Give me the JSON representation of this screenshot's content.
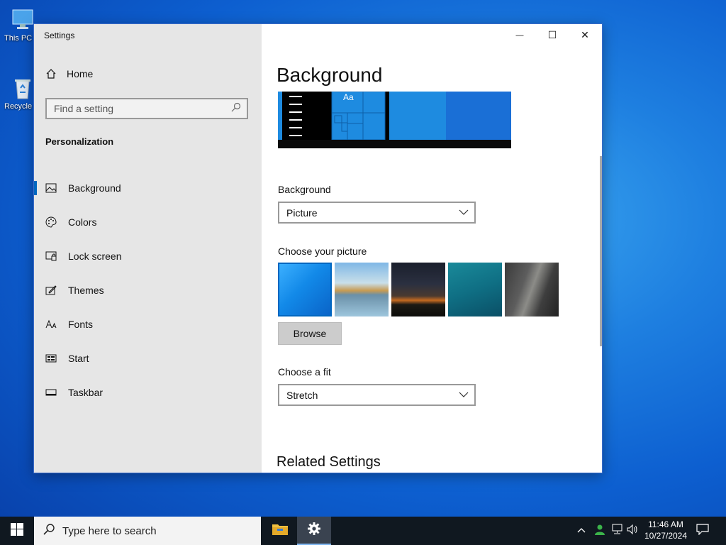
{
  "desktop": {
    "icons": [
      {
        "label": "This PC - Shortcut",
        "icon": "this-pc-icon"
      },
      {
        "label": "Recycle Bin",
        "icon": "recycle-bin-icon"
      }
    ]
  },
  "window": {
    "title": "Settings",
    "controls": {
      "minimize": "—",
      "maximize": "☐",
      "close": "✕"
    }
  },
  "sidebar": {
    "home_label": "Home",
    "search_placeholder": "Find a setting",
    "section_title": "Personalization",
    "items": [
      {
        "label": "Background",
        "icon": "background-icon",
        "active": true
      },
      {
        "label": "Colors",
        "icon": "palette-icon",
        "active": false
      },
      {
        "label": "Lock screen",
        "icon": "lock-screen-icon",
        "active": false
      },
      {
        "label": "Themes",
        "icon": "themes-icon",
        "active": false
      },
      {
        "label": "Fonts",
        "icon": "fonts-icon",
        "active": false
      },
      {
        "label": "Start",
        "icon": "start-icon",
        "active": false
      },
      {
        "label": "Taskbar",
        "icon": "taskbar-icon",
        "active": false
      }
    ]
  },
  "main": {
    "title": "Background",
    "preview_tile_text": "Aa",
    "background_label": "Background",
    "background_value": "Picture",
    "choose_picture_label": "Choose your picture",
    "browse_label": "Browse",
    "fit_label": "Choose a fit",
    "fit_value": "Stretch",
    "related_title": "Related Settings"
  },
  "taskbar": {
    "search_placeholder": "Type here to search",
    "time": "11:46 AM",
    "date": "10/27/2024"
  },
  "colors": {
    "accent": "#0067c0",
    "sidebar_bg": "#e6e6e6",
    "taskbar_bg": "#101820"
  }
}
